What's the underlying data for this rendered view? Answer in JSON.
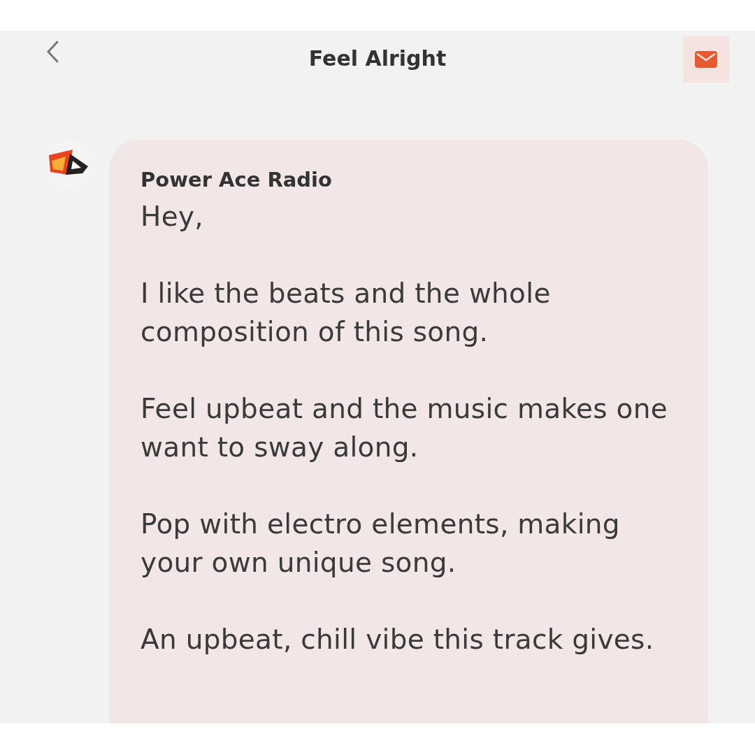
{
  "header": {
    "title": "Feel Alright"
  },
  "message": {
    "sender": "Power Ace Radio",
    "paragraphs": [
      "Hey,",
      "I like the beats and the whole composition of this song.",
      "Feel upbeat and the music makes one want to sway along.",
      "Pop with electro elements, making your own unique song.",
      "An upbeat, chill vibe this track gives."
    ]
  }
}
